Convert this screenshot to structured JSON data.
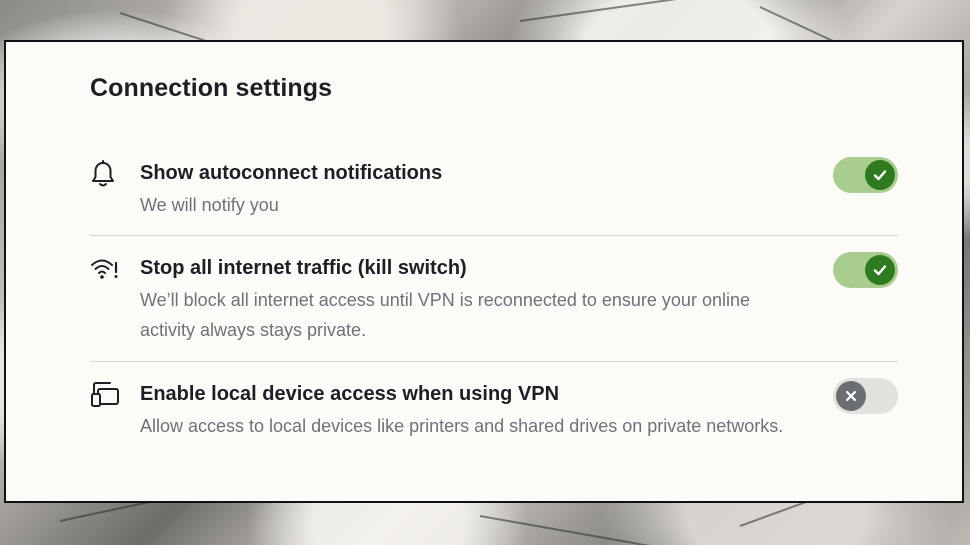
{
  "panel": {
    "title": "Connection settings"
  },
  "settings": [
    {
      "label": "Show autoconnect notifications",
      "description": "We will notify you",
      "icon": "bell-icon",
      "enabled": true
    },
    {
      "label": "Stop all internet traffic (kill switch)",
      "description": "We’ll block all internet access until VPN is reconnected to ensure your online activity always stays private.",
      "icon": "wifi-alert-icon",
      "enabled": true
    },
    {
      "label": "Enable local device access when using VPN",
      "description": "Allow access to local devices like printers and shared drives on private networks.",
      "icon": "devices-icon",
      "enabled": false
    }
  ],
  "colors": {
    "toggle_on_track": "#a9cc8f",
    "toggle_on_knob": "#2f7a1e",
    "toggle_off_track": "#e3e1de",
    "toggle_off_knob": "#6b6f74"
  }
}
